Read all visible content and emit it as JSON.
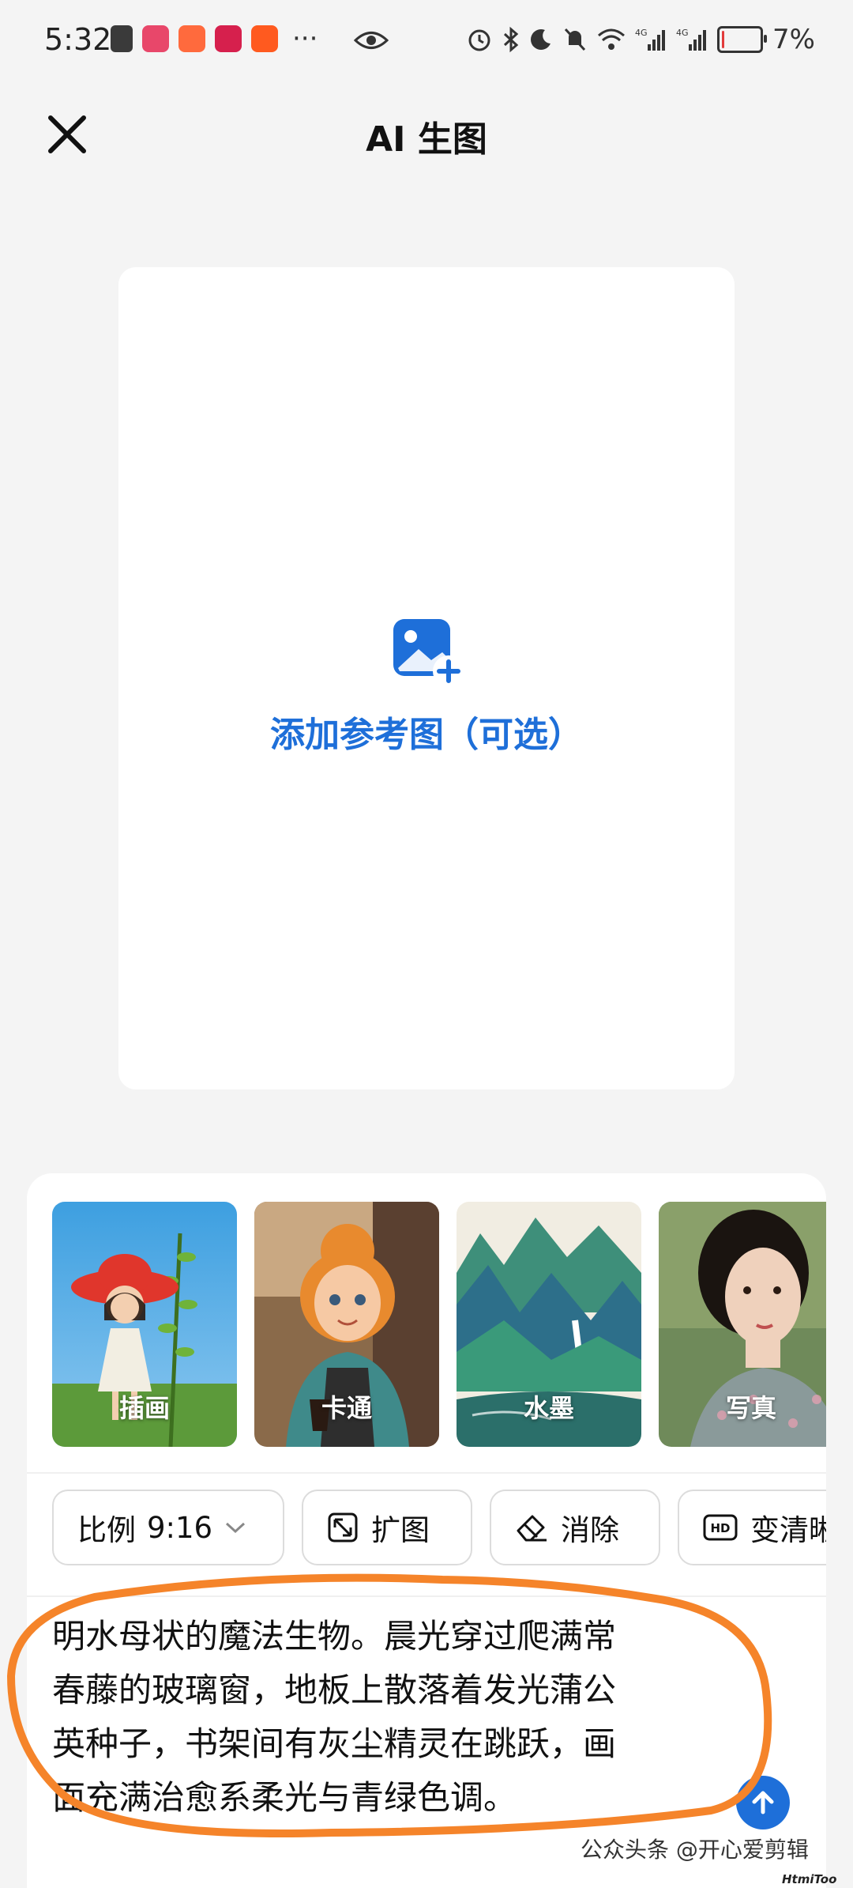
{
  "status_bar": {
    "time": "5:32",
    "more": "···",
    "network": "4G",
    "battery": "7%",
    "battery_level": 0.07
  },
  "header": {
    "title": "AI 生图"
  },
  "upload": {
    "label": "添加参考图（可选）"
  },
  "styles": [
    {
      "label": "插画"
    },
    {
      "label": "卡通"
    },
    {
      "label": "水墨"
    },
    {
      "label": "写真"
    }
  ],
  "tools": {
    "ratio_label": "比例",
    "ratio_value": "9:16",
    "expand": "扩图",
    "erase": "消除",
    "enhance": "变清晰"
  },
  "prompt": {
    "lines": [
      "明水母状的魔法生物。晨光穿过爬满常",
      "春藤的玻璃窗，地板上散落着发光蒲公",
      "英种子，书架间有灰尘精灵在跳跃，画",
      "面充满治愈系柔光与青绿色调。"
    ]
  },
  "watermark": {
    "text": "公众头条 @开心爱剪辑",
    "small": "HtmiToo"
  },
  "colors": {
    "accent": "#1e6fd9",
    "annotation": "#f5842a",
    "battery_low": "#e23b3b"
  }
}
